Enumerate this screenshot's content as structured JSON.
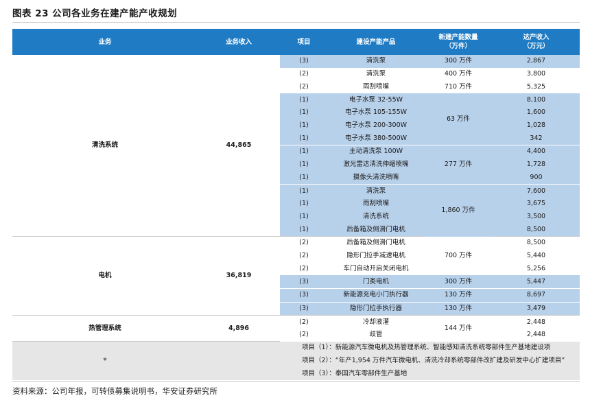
{
  "figure_title": "图表 23 公司各业务在建产能产收规划",
  "headers": [
    "业务",
    "业务收入",
    "项目",
    "建设产能产品",
    "新建产能数量\n（万件）",
    "达产收入\n（万元）"
  ],
  "business": [
    {
      "name": "清洗系统",
      "revenue": "44,865"
    },
    {
      "name": "电机",
      "revenue": "36,819"
    },
    {
      "name": "热管理系统",
      "revenue": "4,896"
    }
  ],
  "rows": [
    {
      "project": "(3)",
      "product": "清洗泵",
      "capacity": "300 万件",
      "income": "2,867"
    },
    {
      "project": "(2)",
      "product": "清洗泵",
      "capacity": "400 万件",
      "income": "3,800"
    },
    {
      "project": "(2)",
      "product": "雨刮喷嘴",
      "capacity": "710 万件",
      "income": "5,325"
    },
    {
      "project": "(1)",
      "product": "电子水泵 32-55W",
      "capacity": "",
      "income": "8,100"
    },
    {
      "project": "(1)",
      "product": "电子水泵 105-155W",
      "capacity": "63 万件",
      "income": "1,600"
    },
    {
      "project": "(1)",
      "product": "电子水泵 200-300W",
      "capacity": "",
      "income": "1,028"
    },
    {
      "project": "(1)",
      "product": "电子水泵 380-500W",
      "capacity": "",
      "income": "342"
    },
    {
      "project": "(1)",
      "product": "主动清洗泵 100W",
      "capacity": "",
      "income": "4,400"
    },
    {
      "project": "(1)",
      "product": "激光雷达清洗伸缩喷嘴",
      "capacity": "277 万件",
      "income": "1,728"
    },
    {
      "project": "(1)",
      "product": "摄像头清洗喷嘴",
      "capacity": "",
      "income": "900"
    },
    {
      "project": "(1)",
      "product": "清洗泵",
      "capacity": "",
      "income": "7,600"
    },
    {
      "project": "(1)",
      "product": "雨刮喷嘴",
      "capacity": "1,860 万件",
      "income": "3,675"
    },
    {
      "project": "(1)",
      "product": "清洗系统",
      "capacity": "",
      "income": "3,500"
    },
    {
      "project": "(1)",
      "product": "后备箱及侧滑门电机",
      "capacity": "",
      "income": "8,500"
    },
    {
      "project": "(2)",
      "product": "后备箱及侧滑门电机",
      "capacity": "",
      "income": "8,500"
    },
    {
      "project": "(2)",
      "product": "隐形门拉手减速电机",
      "capacity": "700 万件",
      "income": "5,440"
    },
    {
      "project": "(2)",
      "product": "车门自动开启关闭电机",
      "capacity": "",
      "income": "5,256"
    },
    {
      "project": "(3)",
      "product": "门类电机",
      "capacity": "300 万件",
      "income": "5,447"
    },
    {
      "project": "(3)",
      "product": "新能源充电小门执行器",
      "capacity": "130 万件",
      "income": "8,697"
    },
    {
      "project": "(3)",
      "product": "隐形门拉手执行器",
      "capacity": "130 万件",
      "income": "3,479"
    },
    {
      "project": "(2)",
      "product": "冷却液灌",
      "capacity": "144 万件",
      "income": "2,448"
    },
    {
      "project": "(2)",
      "product": "歧管",
      "capacity": "",
      "income": "2,448"
    }
  ],
  "notes": {
    "star": "*",
    "lines": [
      "项目（1）：新能源汽车微电机及热管理系统、智能感知清洗系统零部件生产基地建设项",
      "项目（2）：“年产1,954 万件汽车微电机、清洗冷却系统零部件改扩建及研发中心扩建项目”",
      "项目（3）：泰国汽车零部件生产基地"
    ]
  },
  "source": "资料来源：公司年报，可转债募集说明书，华安证券研究所",
  "colors": {
    "header_bg": "#1e7bc4",
    "shade": "#b8d1eb",
    "note_bg": "#e6e6e6"
  }
}
